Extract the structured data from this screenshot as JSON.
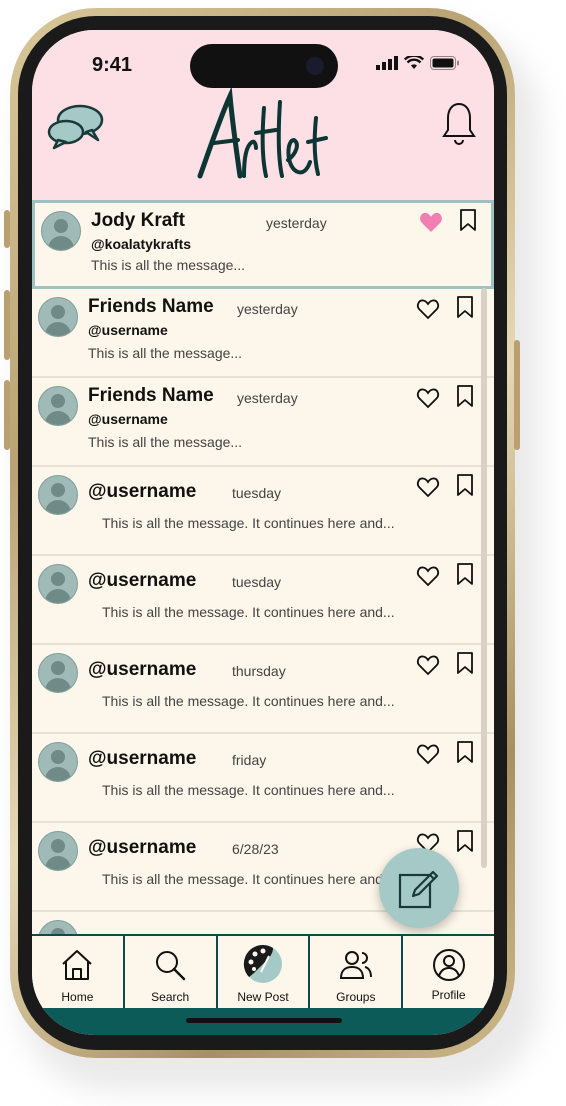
{
  "status_bar": {
    "time": "9:41"
  },
  "header": {
    "logo_text": "Artlet"
  },
  "messages": [
    {
      "name": "Jody Kraft",
      "time": "yesterday",
      "handle": "@koalatykrafts",
      "preview": "This is all the message...",
      "liked": true,
      "selected": true
    },
    {
      "name": "Friends Name",
      "time": "yesterday",
      "handle": "@username",
      "preview": "This is all the message...",
      "liked": false
    },
    {
      "name": "Friends Name",
      "time": "yesterday",
      "handle": "@username",
      "preview": "This is all the message...",
      "liked": false
    },
    {
      "name": "@username",
      "time": "tuesday",
      "preview": "This is all the message. It continues here and...",
      "liked": false
    },
    {
      "name": "@username",
      "time": "tuesday",
      "preview": "This is all the message. It continues here and...",
      "liked": false
    },
    {
      "name": "@username",
      "time": "thursday",
      "preview": "This is all the message. It continues here and...",
      "liked": false
    },
    {
      "name": "@username",
      "time": "friday",
      "preview": "This is all the message. It continues here and...",
      "liked": false
    },
    {
      "name": "@username",
      "time": "6/28/23",
      "preview": "This is all the message. It continues here and...",
      "liked": false
    }
  ],
  "tabbar": {
    "tabs": [
      {
        "label": "Home",
        "icon": "home-icon"
      },
      {
        "label": "Search",
        "icon": "search-icon"
      },
      {
        "label": "New Post",
        "icon": "palette-icon"
      },
      {
        "label": "Groups",
        "icon": "groups-icon"
      },
      {
        "label": "Profile",
        "icon": "profile-icon"
      }
    ]
  },
  "colors": {
    "header_bg": "#fde0e6",
    "feed_bg": "#fdf6ea",
    "accent_teal": "#0c4b4a",
    "heart_pink": "#f27fb4",
    "fab_bg": "#a5c9c7"
  }
}
